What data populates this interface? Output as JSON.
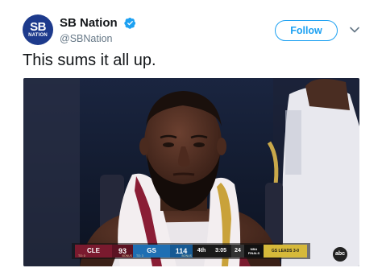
{
  "tweet": {
    "author": {
      "display_name": "SB Nation",
      "handle": "@SBNation",
      "avatar_big": "SB",
      "avatar_small": "NATION",
      "verified": true,
      "avatar_color": "#1d3a8c"
    },
    "follow_label": "Follow",
    "more_icon": "chevron-down-icon",
    "text": "This sums it all up."
  },
  "media": {
    "scorebug": {
      "away_team": "CLE",
      "away_score": "93",
      "away_timeouts": "TO: 0",
      "away_bonus": "BONUS",
      "home_team": "GS",
      "home_score": "114",
      "home_timeouts": "TO: 3",
      "home_bonus": "BONUS",
      "quarter": "4th",
      "clock": "3:05",
      "shot_clock": "24",
      "event_logo": "NBA FINALS",
      "series_status": "GS LEADS 3-0",
      "away_color": "#7a1a2e",
      "home_color": "#1f6fb3"
    },
    "network_logo": "abc"
  },
  "colors": {
    "accent": "#1da1f2",
    "text": "#14171a",
    "secondary_text": "#657786"
  }
}
